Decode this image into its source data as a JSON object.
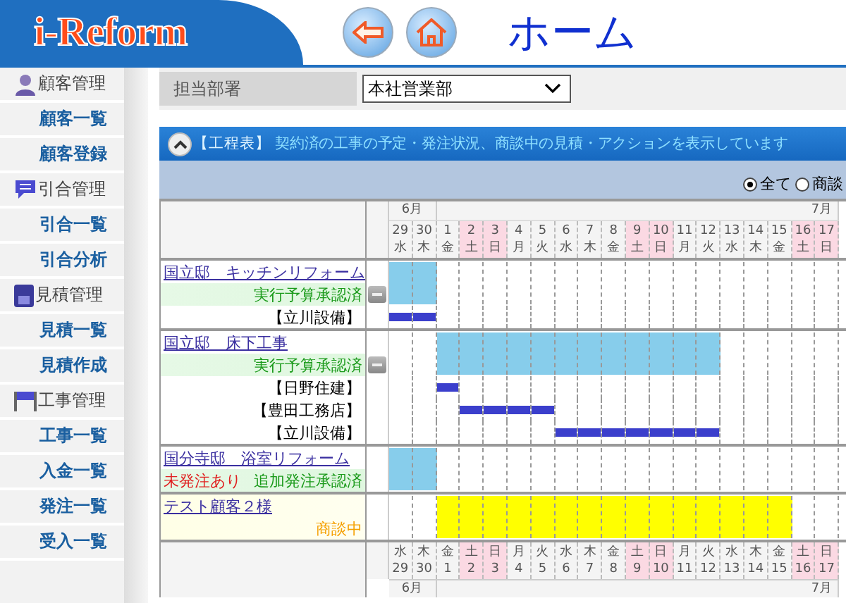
{
  "header": {
    "logo": "i-Reform",
    "title": "ホーム"
  },
  "sidebar": {
    "sections": [
      {
        "label": "顧客管理",
        "kind": "customer",
        "items": [
          {
            "label": "顧客一覧"
          },
          {
            "label": "顧客登録"
          }
        ]
      },
      {
        "label": "引合管理",
        "kind": "inquiry",
        "items": [
          {
            "label": "引合一覧"
          },
          {
            "label": "引合分析"
          }
        ]
      },
      {
        "label": "見積管理",
        "kind": "estimate",
        "items": [
          {
            "label": "見積一覧"
          },
          {
            "label": "見積作成"
          }
        ]
      },
      {
        "label": "工事管理",
        "kind": "construction",
        "items": [
          {
            "label": "工事一覧"
          },
          {
            "label": "入金一覧"
          },
          {
            "label": "発注一覧"
          },
          {
            "label": "受入一覧"
          }
        ]
      }
    ]
  },
  "filter": {
    "label": "担当部署",
    "value": "本社営業部"
  },
  "panel": {
    "title": "【工程表】",
    "description": "契約済の工事の予定・発注状況、商談中の見積・アクションを表示しています",
    "expanded": true
  },
  "radios": [
    {
      "label": "全て",
      "selected": true
    },
    {
      "label": "商談",
      "selected": false
    }
  ],
  "gantt": {
    "days": [
      {
        "month": "6月",
        "day": "29",
        "weekday": "水",
        "weekend": false
      },
      {
        "day": "30",
        "weekday": "木",
        "weekend": false
      },
      {
        "month": "7月",
        "day": "1",
        "weekday": "金",
        "weekend": false
      },
      {
        "day": "2",
        "weekday": "土",
        "weekend": true
      },
      {
        "day": "3",
        "weekday": "日",
        "weekend": true
      },
      {
        "day": "4",
        "weekday": "月",
        "weekend": false
      },
      {
        "day": "5",
        "weekday": "火",
        "weekend": false
      },
      {
        "day": "6",
        "weekday": "水",
        "weekend": false
      },
      {
        "day": "7",
        "weekday": "木",
        "weekend": false
      },
      {
        "day": "8",
        "weekday": "金",
        "weekend": false
      },
      {
        "day": "9",
        "weekday": "土",
        "weekend": true
      },
      {
        "day": "10",
        "weekday": "日",
        "weekend": true
      },
      {
        "day": "11",
        "weekday": "月",
        "weekend": false
      },
      {
        "day": "12",
        "weekday": "火",
        "weekend": false
      },
      {
        "day": "13",
        "weekday": "水",
        "weekend": false
      },
      {
        "day": "14",
        "weekday": "木",
        "weekend": false
      },
      {
        "day": "15",
        "weekday": "金",
        "weekend": false
      },
      {
        "day": "16",
        "weekday": "土",
        "weekend": true
      },
      {
        "day": "17",
        "weekday": "日",
        "weekend": true
      }
    ],
    "projects": [
      {
        "title": "国立邸　キッチンリフォーム",
        "negotiating": false,
        "toggle": true,
        "statuses": [
          {
            "text": "実行予算承認済",
            "kind": "approved"
          }
        ],
        "schedule": [
          true,
          true,
          false,
          false,
          false,
          false,
          false,
          false,
          false,
          false,
          false,
          false,
          false,
          false,
          false,
          false,
          false,
          false,
          false
        ],
        "vendors": [
          {
            "name": "【立川設備】",
            "bars": [
              true,
              true,
              false,
              false,
              false,
              false,
              false,
              false,
              false,
              false,
              false,
              false,
              false,
              false,
              false,
              false,
              false,
              false,
              false
            ]
          }
        ]
      },
      {
        "title": "国立邸　床下工事",
        "negotiating": false,
        "toggle": true,
        "statuses": [
          {
            "text": "実行予算承認済",
            "kind": "approved"
          }
        ],
        "schedule": [
          false,
          false,
          true,
          true,
          true,
          true,
          true,
          true,
          true,
          true,
          true,
          true,
          true,
          true,
          false,
          false,
          false,
          false,
          false
        ],
        "vendors": [
          {
            "name": "【日野住建】",
            "bars": [
              false,
              false,
              true,
              false,
              false,
              false,
              false,
              false,
              false,
              false,
              false,
              false,
              false,
              false,
              false,
              false,
              false,
              false,
              false
            ]
          },
          {
            "name": "【豊田工務店】",
            "bars": [
              false,
              false,
              false,
              true,
              true,
              true,
              true,
              false,
              false,
              false,
              false,
              false,
              false,
              false,
              false,
              false,
              false,
              false,
              false
            ]
          },
          {
            "name": "【立川設備】",
            "bars": [
              false,
              false,
              false,
              false,
              false,
              false,
              false,
              true,
              true,
              true,
              true,
              true,
              true,
              true,
              false,
              false,
              false,
              false,
              false
            ]
          }
        ]
      },
      {
        "title": "国分寺邸　浴室リフォーム",
        "negotiating": false,
        "toggle": false,
        "statuses": [
          {
            "text": "未発注あり",
            "kind": "warning"
          },
          {
            "text": "追加発注承認済",
            "kind": "approved"
          }
        ],
        "schedule": [
          true,
          true,
          false,
          false,
          false,
          false,
          false,
          false,
          false,
          false,
          false,
          false,
          false,
          false,
          false,
          false,
          false,
          false,
          false
        ]
      },
      {
        "title": "テスト顧客２様",
        "negotiating": true,
        "toggle": false,
        "statuses": [
          {
            "text": "商談中",
            "kind": "negotiating"
          }
        ],
        "schedule": [
          false,
          false,
          true,
          true,
          true,
          true,
          true,
          true,
          true,
          true,
          true,
          true,
          true,
          true,
          true,
          true,
          true,
          false,
          false
        ]
      }
    ],
    "footer_days": [
      {
        "month": "6月",
        "day": "29",
        "weekday": "水",
        "weekend": false
      },
      {
        "day": "30",
        "weekday": "木",
        "weekend": false
      },
      {
        "month": "7月",
        "day": "1",
        "weekday": "金",
        "weekend": false
      },
      {
        "day": "2",
        "weekday": "土",
        "weekend": true
      },
      {
        "day": "3",
        "weekday": "日",
        "weekend": true
      },
      {
        "day": "4",
        "weekday": "月",
        "weekend": false
      },
      {
        "day": "5",
        "weekday": "火",
        "weekend": false
      },
      {
        "day": "6",
        "weekday": "水",
        "weekend": false
      },
      {
        "day": "7",
        "weekday": "木",
        "weekend": false
      },
      {
        "day": "8",
        "weekday": "金",
        "weekend": false
      },
      {
        "day": "9",
        "weekday": "土",
        "weekend": true
      },
      {
        "day": "10",
        "weekday": "日",
        "weekend": true
      },
      {
        "day": "11",
        "weekday": "月",
        "weekend": false
      },
      {
        "day": "12",
        "weekday": "火",
        "weekend": false
      },
      {
        "day": "13",
        "weekday": "水",
        "weekend": false
      },
      {
        "day": "14",
        "weekday": "木",
        "weekend": false
      },
      {
        "day": "15",
        "weekday": "金",
        "weekend": false
      },
      {
        "day": "16",
        "weekday": "土",
        "weekend": true
      },
      {
        "day": "17",
        "weekday": "日",
        "weekend": true
      }
    ]
  }
}
